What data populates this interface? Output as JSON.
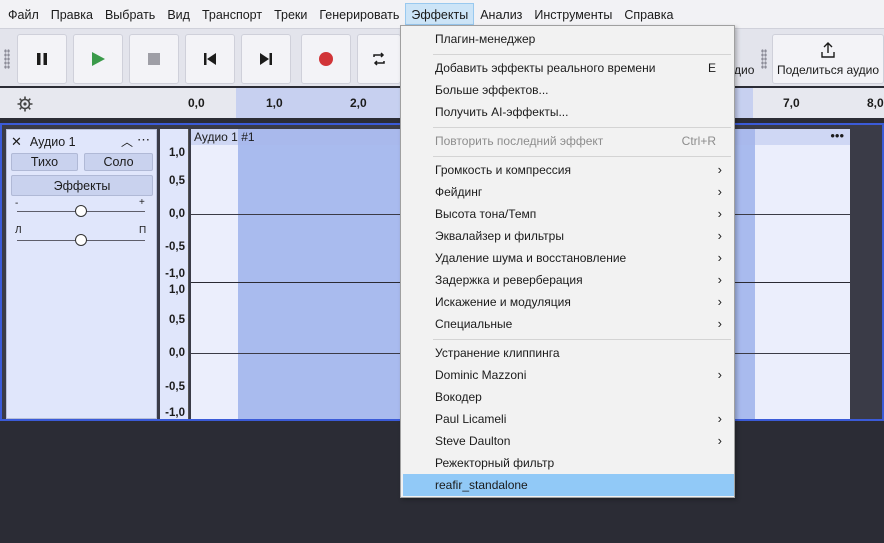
{
  "menubar": {
    "items": [
      "Файл",
      "Правка",
      "Выбрать",
      "Вид",
      "Транспорт",
      "Треки",
      "Генерировать",
      "Эффекты",
      "Анализ",
      "Инструменты",
      "Справка"
    ]
  },
  "toolbar": {
    "share_label": "Поделиться аудио",
    "audio_tail": "дио"
  },
  "ruler": {
    "ticks": [
      "0,0",
      "1,0",
      "2,0",
      "7,0",
      "8,0"
    ]
  },
  "track": {
    "name": "Аудио 1",
    "mute": "Тихо",
    "solo": "Соло",
    "effects": "Эффекты",
    "gain_minus": "-",
    "gain_plus": "+",
    "pan_left": "Л",
    "pan_right": "П",
    "clip_name": "Аудио 1 #1",
    "scale": [
      "1,0",
      "0,5",
      "0,0",
      "-0,5",
      "-1,0",
      "1,0",
      "0,5",
      "0,0",
      "-0,5",
      "-1,0"
    ]
  },
  "effects_menu": {
    "items": [
      {
        "label": "Плагин-менеджер"
      },
      {
        "label": "Добавить эффекты реального времени",
        "shortcut": "E"
      },
      {
        "label": "Больше эффектов..."
      },
      {
        "label": "Получить AI-эффекты..."
      },
      {
        "label": "Повторить последний эффект",
        "shortcut": "Ctrl+R",
        "disabled": true
      },
      {
        "label": "Громкость и компрессия",
        "submenu": true
      },
      {
        "label": "Фейдинг",
        "submenu": true
      },
      {
        "label": "Высота тона/Темп",
        "submenu": true
      },
      {
        "label": "Эквалайзер и фильтры",
        "submenu": true
      },
      {
        "label": "Удаление шума и восстановление",
        "submenu": true
      },
      {
        "label": "Задержка и реверберация",
        "submenu": true
      },
      {
        "label": "Искажение и модуляция",
        "submenu": true
      },
      {
        "label": "Специальные",
        "submenu": true
      },
      {
        "label": "Устранение клиппинга"
      },
      {
        "label": "Dominic Mazzoni",
        "submenu": true
      },
      {
        "label": "Вокодер"
      },
      {
        "label": "Paul Licameli",
        "submenu": true
      },
      {
        "label": "Steve Daulton",
        "submenu": true
      },
      {
        "label": "Режекторный фильтр"
      },
      {
        "label": "reafir_standalone",
        "highlighted": true
      }
    ]
  },
  "colors": {
    "selection": "#a9bbee",
    "highlight": "#91c9f7",
    "play": "#3a9a4a",
    "record": "#d13438"
  }
}
